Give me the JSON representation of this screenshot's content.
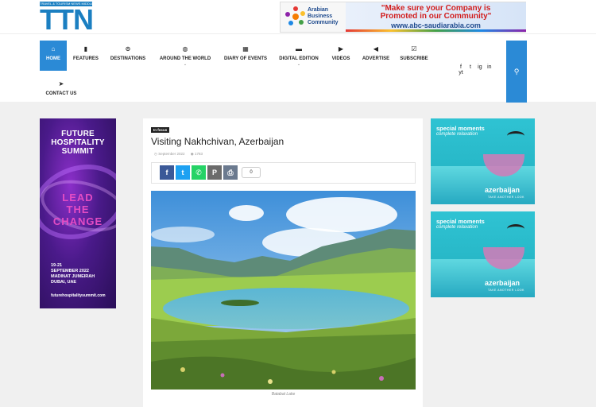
{
  "header": {
    "logo_tagline": "TRAVEL & TOURISM NEWS MIDDLE EAST",
    "logo_text": "TTN",
    "banner": {
      "org_line1": "Arabian",
      "org_line2": "Business",
      "org_line3": "Community",
      "promo_line1": "\"Make sure your Company is",
      "promo_line2": "Promoted in our Community\"",
      "promo_url": "www.abc-saudiarabia.com"
    }
  },
  "nav": {
    "items": [
      {
        "label": "HOME",
        "icon": "home-icon"
      },
      {
        "label": "FEATURES",
        "icon": "bookmark-icon"
      },
      {
        "label": "DESTINATIONS",
        "icon": "map-pin-icon"
      },
      {
        "label": "AROUND THE WORLD",
        "icon": "globe-icon"
      },
      {
        "label": "DIARY OF EVENTS",
        "icon": "calendar-icon"
      },
      {
        "label": "DIGITAL EDITION",
        "icon": "book-icon"
      },
      {
        "label": "VIDEOS",
        "icon": "video-icon"
      },
      {
        "label": "ADVERTISE",
        "icon": "megaphone-icon"
      },
      {
        "label": "SUBSCRIBE",
        "icon": "checkbox-icon"
      },
      {
        "label": "CONTACT US",
        "icon": "paper-plane-icon"
      }
    ],
    "social": [
      "f",
      "t",
      "ig",
      "in",
      "yt"
    ]
  },
  "left_ad": {
    "title_l1": "FUTURE",
    "title_l2": "HOSPITALITY",
    "title_l3": "SUMMIT",
    "slogan_l1": "LEAD",
    "slogan_l2": "THE",
    "slogan_l3": "CHANGE",
    "dates_l1": "19-21",
    "dates_l2": "SEPTEMBER 2022",
    "dates_l3": "MADINAT JUMEIRAH",
    "dates_l4": "DUBAI, UAE",
    "url": "futurehospitalitysummit.com"
  },
  "article": {
    "badge": "In focus",
    "title": "Visiting Nakhchivan, Azerbaijan",
    "date": "September 2022",
    "views": "1783",
    "share_count": "0",
    "caption": "Batabat Lake"
  },
  "right_ads": [
    {
      "headline": "special moments",
      "subline": "complete relaxation",
      "brand": "azerbaijan",
      "tagline": "TAKE ANOTHER LOOK"
    },
    {
      "headline": "special moments",
      "subline": "complete relaxation",
      "brand": "azerbaijan",
      "tagline": "TAKE ANOTHER LOOK"
    }
  ],
  "colors": {
    "brand_blue": "#2b8ad6",
    "promo_red": "#d21d1d",
    "ad_purple": "#4a1a8a",
    "ad_pink": "#e44cc4",
    "sea_teal": "#27b7c7"
  }
}
